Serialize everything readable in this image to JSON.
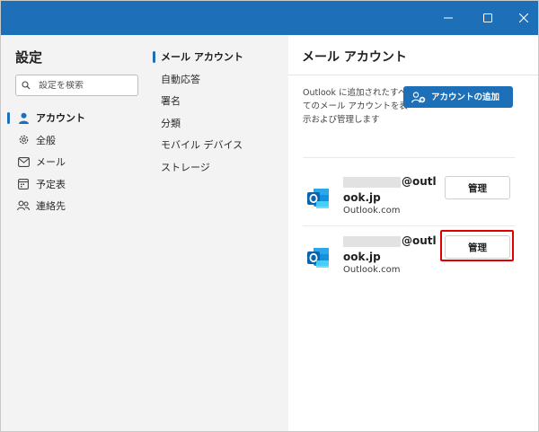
{
  "colors": {
    "accent": "#1d6fb8",
    "titlebar": "#1d6fb8",
    "highlight": "#e00000",
    "pane_bg": "#f3f3f3",
    "content_bg": "#ffffff"
  },
  "window": {
    "controls": [
      "minimize-icon",
      "maximize-icon",
      "close-icon"
    ]
  },
  "nav": {
    "title": "設定",
    "search_placeholder": "設定を検索",
    "items": [
      {
        "label": "アカウント",
        "icon": "person-icon",
        "active": true
      },
      {
        "label": "全般",
        "icon": "gear-icon",
        "active": false
      },
      {
        "label": "メール",
        "icon": "mail-icon",
        "active": false
      },
      {
        "label": "予定表",
        "icon": "calendar-icon",
        "active": false
      },
      {
        "label": "連絡先",
        "icon": "people-icon",
        "active": false
      }
    ]
  },
  "subnav": {
    "items": [
      {
        "label": "メール アカウント",
        "active": true
      },
      {
        "label": "自動応答",
        "active": false
      },
      {
        "label": "署名",
        "active": false
      },
      {
        "label": "分類",
        "active": false
      },
      {
        "label": "モバイル デバイス",
        "active": false
      },
      {
        "label": "ストレージ",
        "active": false
      }
    ]
  },
  "content": {
    "title": "メール アカウント",
    "description": "Outlook に追加されたすべてのメール アカウントを表示および管理します",
    "add_account_label": "アカウントの追加",
    "accounts": [
      {
        "email_visible": "@outl",
        "email_line2": "ook.jp",
        "provider": "Outlook.com",
        "manage_label": "管理",
        "highlighted": false
      },
      {
        "email_visible": "@outl",
        "email_line2": "ook.jp",
        "provider": "Outlook.com",
        "manage_label": "管理",
        "highlighted": true
      }
    ]
  }
}
